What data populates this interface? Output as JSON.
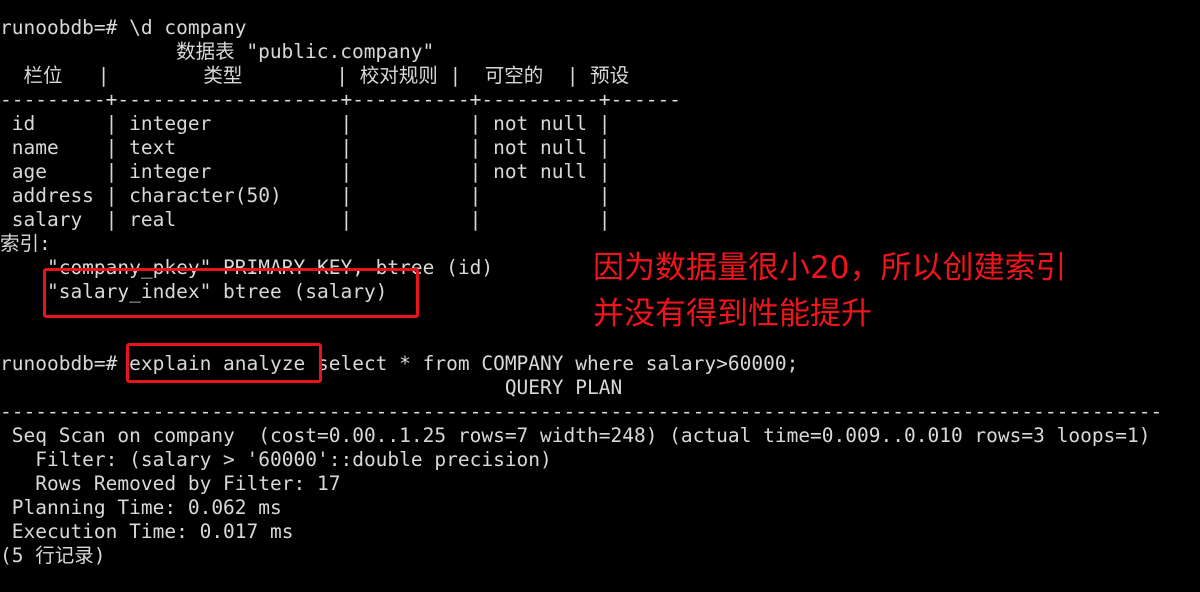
{
  "terminal": {
    "lines": [
      "runoobdb=# \\d company",
      "               数据表 \"public.company\"",
      "  栏位   |        类型        | 校对规则 |  可空的  | 预设",
      "---------+-------------------+----------+----------+------",
      " id      | integer           |          | not null |",
      " name    | text              |          | not null |",
      " age     | integer           |          | not null |",
      " address | character(50)     |          |          |",
      " salary  | real              |          |          |",
      "索引:",
      "    \"company_pkey\" PRIMARY KEY, btree (id)",
      "    \"salary_index\" btree (salary)",
      "",
      "runoobdb=# explain analyze select * from COMPANY where salary>60000;",
      "                                           QUERY PLAN",
      "---------------------------------------------------------------------------------------------------",
      " Seq Scan on company  (cost=0.00..1.25 rows=7 width=248) (actual time=0.009..0.010 rows=3 loops=1)",
      "   Filter: (salary > '60000'::double precision)",
      "   Rows Removed by Filter: 17",
      " Planning Time: 0.062 ms",
      " Execution Time: 0.017 ms",
      "(5 行记录)"
    ]
  },
  "annotation": {
    "line1": "因为数据量很小20，所以创建索引",
    "line2": "并没有得到性能提升",
    "color": "#f0151c"
  }
}
